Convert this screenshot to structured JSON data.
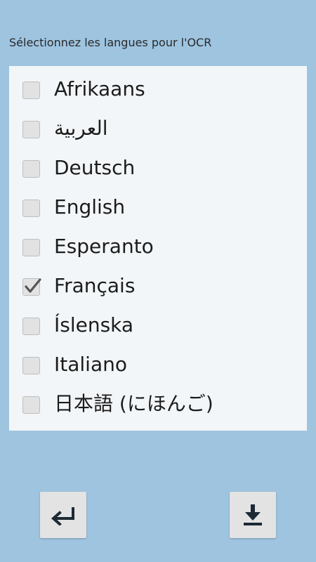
{
  "header": {
    "prompt": "Sélectionnez les langues pour l'OCR"
  },
  "languages": [
    {
      "label": "Afrikaans",
      "checked": false
    },
    {
      "label": "العربية",
      "checked": false
    },
    {
      "label": "Deutsch",
      "checked": false
    },
    {
      "label": "English",
      "checked": false
    },
    {
      "label": "Esperanto",
      "checked": false
    },
    {
      "label": "Français",
      "checked": true
    },
    {
      "label": "Íslenska",
      "checked": false
    },
    {
      "label": "Italiano",
      "checked": false
    },
    {
      "label": "日本語 (にほんご)",
      "checked": false
    },
    {
      "label": "",
      "checked": false
    }
  ],
  "buttons": {
    "back_icon": "return-arrow-icon",
    "download_icon": "download-icon"
  },
  "colors": {
    "background": "#9ec4e0",
    "panel": "#f3f6f8",
    "checkbox_fill": "#e2e2e2",
    "checkmark": "#555555",
    "icon": "#1c2a36"
  }
}
